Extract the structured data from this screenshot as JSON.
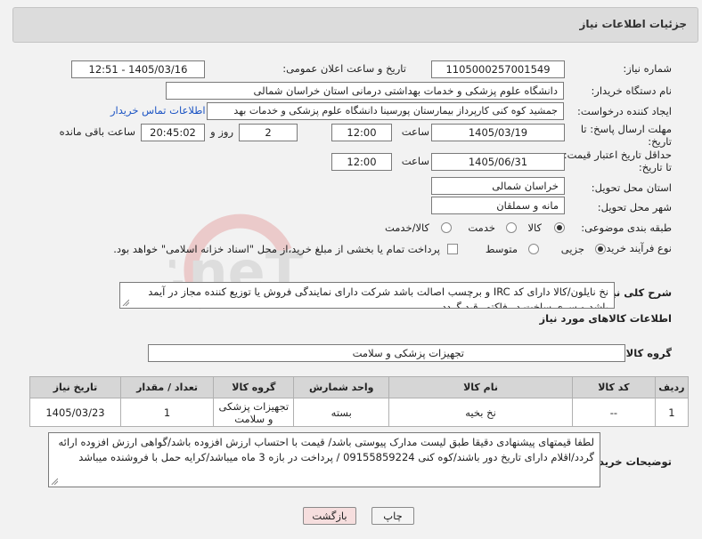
{
  "header": {
    "title": "جزئیات اطلاعات نیاز"
  },
  "need_number": {
    "label": "شماره نیاز:",
    "value": "1105000257001549"
  },
  "announce": {
    "label": "تاریخ و ساعت اعلان عمومی:",
    "value": "1405/03/16 - 12:51"
  },
  "buyer_org": {
    "label": "نام دستگاه خریدار:",
    "value": "دانشگاه علوم پزشکی و خدمات بهداشتی درمانی استان خراسان شمالی"
  },
  "requester": {
    "label": "ایجاد کننده درخواست:",
    "value": "جمشید کوه کنی کارپرداز بیمارستان پورسینا دانشگاه علوم پزشکی و خدمات بهد",
    "contact_link": "اطلاعات تماس خریدار"
  },
  "deadline": {
    "label_line1": "مهلت ارسال پاسخ: تا",
    "label_line2": "تاریخ:",
    "date": "1405/03/19",
    "time_label": "ساعت",
    "time": "12:00",
    "days": "2",
    "days_label": "روز و",
    "remaining": "20:45:02",
    "remaining_label": "ساعت باقی مانده"
  },
  "validity": {
    "label_line1": "حداقل تاریخ اعتبار قیمت:",
    "label_line2": "تا تاریخ:",
    "date": "1405/06/31",
    "time_label": "ساعت",
    "time": "12:00"
  },
  "province": {
    "label": "استان محل تحویل:",
    "value": "خراسان شمالی"
  },
  "city": {
    "label": "شهر محل تحویل:",
    "value": "مانه و سملقان"
  },
  "category": {
    "label": "طبقه بندی موضوعی:",
    "options": [
      "کالا",
      "خدمت",
      "کالا/خدمت"
    ],
    "selected": "کالا"
  },
  "process": {
    "label": "نوع فرآیند خرید :",
    "options": [
      "جزیی",
      "متوسط"
    ],
    "selected": "جزیی",
    "payment_note": "پرداخت تمام یا بخشی از مبلغ خرید،از محل \"اسناد خزانه اسلامی\" خواهد بود."
  },
  "description": {
    "label": "شرح کلی نیاز:",
    "text": "نخ نایلون/کالا دارای کد IRC و برچسب اصالت باشد شرکت دارای نمایندگی فروش یا توزیع کننده  مجاز در آیمد باشد و سری ساخت در فاکتور قید گردد"
  },
  "goods_info_title": "اطلاعات کالاهای مورد نیاز",
  "goods_group": {
    "label": "گروه کالا:",
    "value": "تجهیزات پزشکی و سلامت"
  },
  "table": {
    "headers": [
      "ردیف",
      "کد کالا",
      "نام کالا",
      "واحد شمارش",
      "گروه کالا",
      "تعداد / مقدار",
      "تاریخ نیاز"
    ],
    "rows": [
      {
        "row": "1",
        "code": "--",
        "name": "نخ بخیه",
        "unit": "بسته",
        "group": "تجهیزات پزشکی و سلامت",
        "qty": "1",
        "date": "1405/03/23"
      }
    ]
  },
  "buyer_notes": {
    "label": "توضیحات خریدار:",
    "text": "لطفا قیمتهای پیشنهادی دقیقا طبق لیست مدارک پیوستی باشد/ قیمت با احتساب ارزش افزوده باشد/گواهی ارزش افزوده ارائه گردد/اقلام دارای تاریخ دور باشند/کوه کنی 09155859224 / پرداخت در بازه 3 ماه میباشد/کرایه حمل با فروشنده میباشد"
  },
  "buttons": {
    "print": "چاپ",
    "back": "بازگشت"
  },
  "watermark": {
    "text": "AriaTender.neT"
  },
  "colors": {
    "link": "#1d55c4",
    "back_button_bg": "#f6dede",
    "header_bg": "#dcdcdc"
  }
}
